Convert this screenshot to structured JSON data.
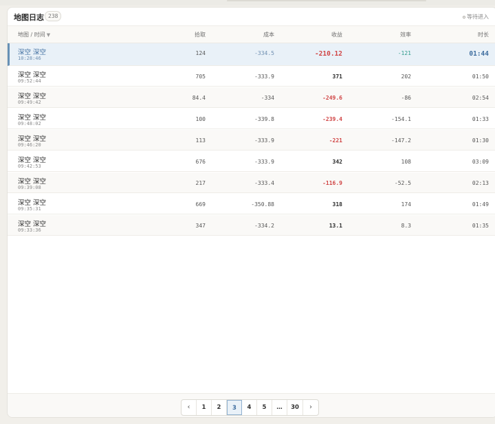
{
  "header": {
    "title": "地图日志",
    "count": "238",
    "status": "等待进入"
  },
  "columns": {
    "map_time": "地图 / 时间",
    "pick": "拾取",
    "cost": "成本",
    "gain": "收益",
    "eff": "效率",
    "dur": "时长"
  },
  "rows": [
    {
      "map": "深空 深空",
      "time": "10:28:46",
      "pick": "124",
      "cost": "-334.5",
      "gain": "-210.12",
      "eff": "-121",
      "dur": "01:44"
    },
    {
      "map": "深空 深空",
      "time": "09:52:44",
      "pick": "705",
      "cost": "-333.9",
      "gain": "371",
      "eff": "202",
      "dur": "01:50"
    },
    {
      "map": "深空 深空",
      "time": "09:49:42",
      "pick": "84.4",
      "cost": "-334",
      "gain": "-249.6",
      "eff": "-86",
      "dur": "02:54"
    },
    {
      "map": "深空 深空",
      "time": "09:48:02",
      "pick": "100",
      "cost": "-339.8",
      "gain": "-239.4",
      "eff": "-154.1",
      "dur": "01:33"
    },
    {
      "map": "深空 深空",
      "time": "09:46:20",
      "pick": "113",
      "cost": "-333.9",
      "gain": "-221",
      "eff": "-147.2",
      "dur": "01:30"
    },
    {
      "map": "深空 深空",
      "time": "09:42:53",
      "pick": "676",
      "cost": "-333.9",
      "gain": "342",
      "eff": "108",
      "dur": "03:09"
    },
    {
      "map": "深空 深空",
      "time": "09:39:08",
      "pick": "217",
      "cost": "-333.4",
      "gain": "-116.9",
      "eff": "-52.5",
      "dur": "02:13"
    },
    {
      "map": "深空 深空",
      "time": "09:35:31",
      "pick": "669",
      "cost": "-350.88",
      "gain": "318",
      "eff": "174",
      "dur": "01:49"
    },
    {
      "map": "深空 深空",
      "time": "09:33:36",
      "pick": "347",
      "cost": "-334.2",
      "gain": "13.1",
      "eff": "8.3",
      "dur": "01:35"
    }
  ],
  "pagination": {
    "prev": "‹",
    "pages": [
      "1",
      "2",
      "3",
      "4",
      "5",
      "…",
      "30"
    ],
    "next": "›",
    "current": "3"
  },
  "colors": {
    "selected_bg": "#e9f1f8",
    "accent": "#3f6ea0",
    "negative": "#d04444",
    "teal": "#2d9a8a"
  },
  "icons": {
    "sort": "sort-down-icon",
    "status": "circle-icon",
    "prev": "chevron-left-icon",
    "next": "chevron-right-icon"
  }
}
